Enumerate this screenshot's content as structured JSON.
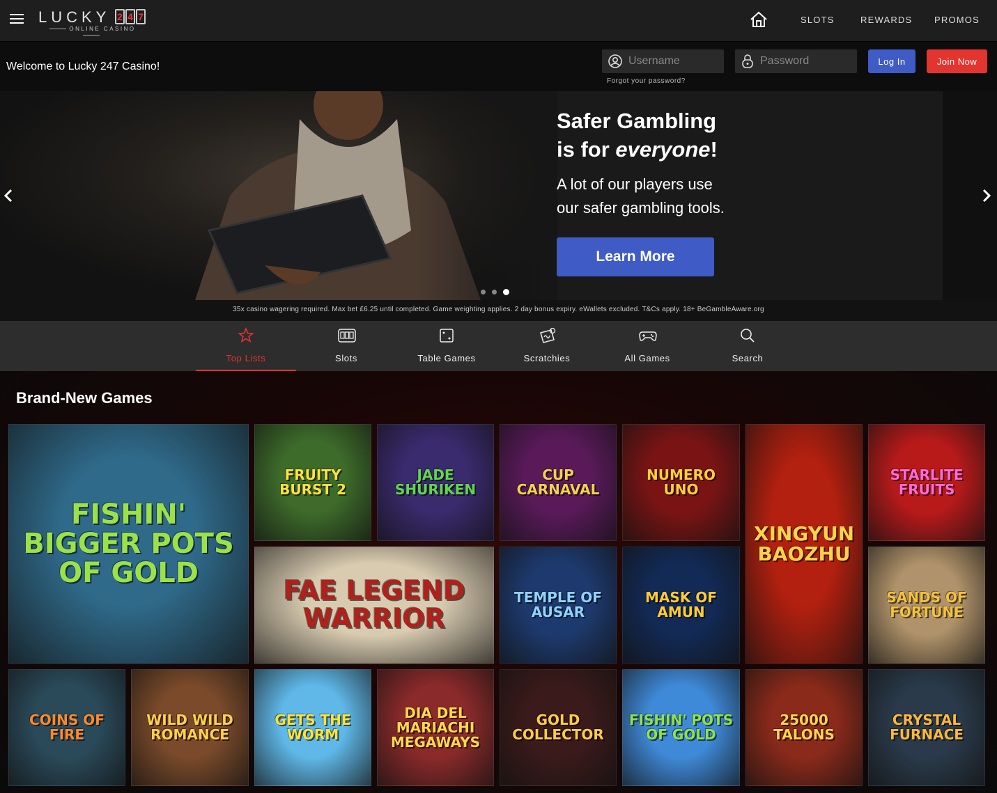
{
  "header": {
    "logo_word": "LUCKY",
    "logo_digits": [
      "2",
      "4",
      "7"
    ],
    "logo_sub": "ONLINE CASINO",
    "nav": [
      "SLOTS",
      "REWARDS",
      "PROMOS"
    ]
  },
  "login": {
    "welcome": "Welcome to Lucky 247 Casino!",
    "username_placeholder": "Username",
    "password_placeholder": "Password",
    "forgot": "Forgot your password?",
    "login_label": "Log In",
    "join_label": "Join Now"
  },
  "hero": {
    "title_line1": "Safer Gambling",
    "title_line2_pre": "is for ",
    "title_line2_em": "everyone",
    "title_line2_post": "!",
    "body_line1": "A lot of our players use",
    "body_line2": "our safer gambling tools.",
    "cta": "Learn More",
    "slide_count": 3,
    "active_slide": 3
  },
  "terms": "35x casino wagering required. Max bet £6.25 until completed. Game weighting applies. 2 day bonus expiry. eWallets excluded. T&Cs apply. 18+ BeGambleAware.org",
  "categories": [
    {
      "label": "Top Lists",
      "icon": "star-icon",
      "active": true
    },
    {
      "label": "Slots",
      "icon": "slot-machine-icon",
      "active": false
    },
    {
      "label": "Table Games",
      "icon": "dice-icon",
      "active": false
    },
    {
      "label": "Scratchies",
      "icon": "scratch-card-icon",
      "active": false
    },
    {
      "label": "All Games",
      "icon": "gamepad-icon",
      "active": false
    },
    {
      "label": "Search",
      "icon": "search-icon",
      "active": false
    }
  ],
  "section_title": "Brand-New Games",
  "games": [
    {
      "name": "Fishin' Bigger Pots of Gold",
      "bg": "#2f6a8a",
      "fg": "#9be24a"
    },
    {
      "name": "Fruity Burst 2",
      "bg": "#3d6b2a",
      "fg": "#ffe23a"
    },
    {
      "name": "Jade Shuriken",
      "bg": "#3a2a6e",
      "fg": "#5fd84a"
    },
    {
      "name": "Cup Carnaval",
      "bg": "#5a1a5a",
      "fg": "#f3d24a"
    },
    {
      "name": "Numero Uno",
      "bg": "#7a1414",
      "fg": "#ffcf3a"
    },
    {
      "name": "Xingyun Baozhu",
      "bg": "#b3200f",
      "fg": "#ffd24a"
    },
    {
      "name": "Starlite Fruits",
      "bg": "#b81a1a",
      "fg": "#ff6ad8"
    },
    {
      "name": "Fae Legend Warrior",
      "bg": "#d8cbb0",
      "fg": "#b1201a"
    },
    {
      "name": "Temple of Ausar",
      "bg": "#1d3a6e",
      "fg": "#8fd3ff"
    },
    {
      "name": "Mask of Amun",
      "bg": "#122a55",
      "fg": "#ffcc33"
    },
    {
      "name": "Sands of Fortune",
      "bg": "#b0936a",
      "fg": "#f6c23a"
    },
    {
      "name": "Coins of Fire",
      "bg": "#2a4a5a",
      "fg": "#ff8a2a"
    },
    {
      "name": "Wild Wild Romance",
      "bg": "#7a4a2a",
      "fg": "#ffd04a"
    },
    {
      "name": "Gets the Worm",
      "bg": "#5fb8e8",
      "fg": "#ffe33a"
    },
    {
      "name": "Dia del Mariachi Megaways",
      "bg": "#8a2a2a",
      "fg": "#ffd84a"
    },
    {
      "name": "Gold Collector",
      "bg": "#3a1a1a",
      "fg": "#ffcc44"
    },
    {
      "name": "Fishin' Pots of Gold",
      "bg": "#3f8ad8",
      "fg": "#8fe34a"
    },
    {
      "name": "25000 Talons",
      "bg": "#8a2a1a",
      "fg": "#ffd34a"
    },
    {
      "name": "Crystal Furnace",
      "bg": "#2a3a4a",
      "fg": "#ffb83a"
    }
  ]
}
